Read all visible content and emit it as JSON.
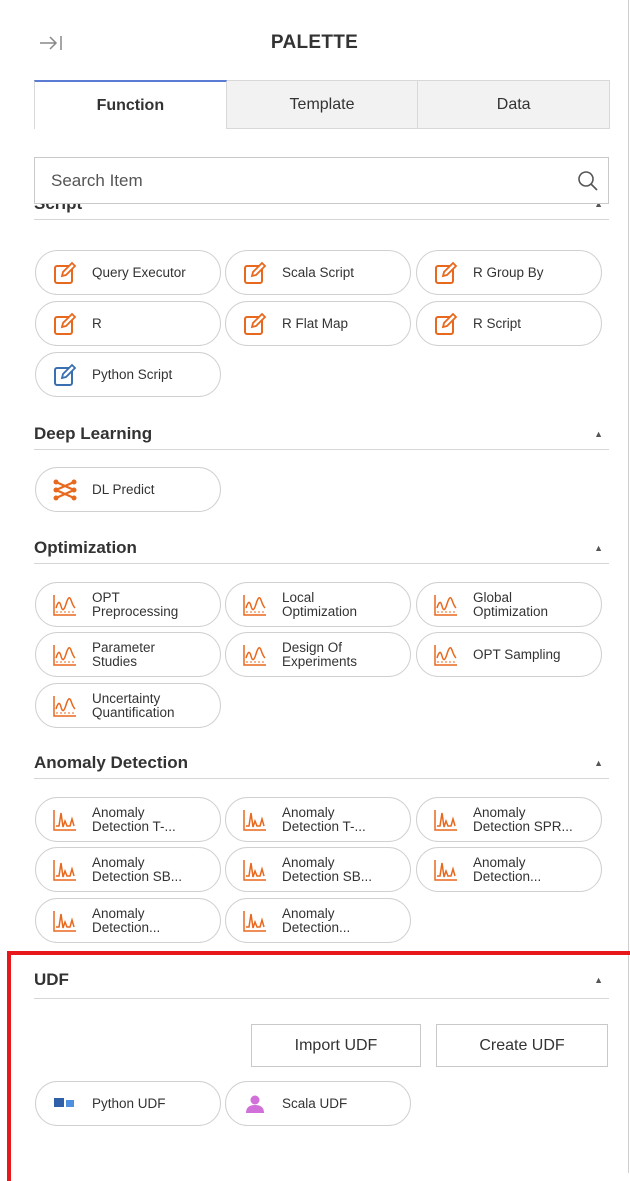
{
  "header": {
    "title": "PALETTE"
  },
  "tabs": [
    {
      "label": "Function",
      "active": true
    },
    {
      "label": "Template",
      "active": false
    },
    {
      "label": "Data",
      "active": false
    }
  ],
  "search": {
    "placeholder": "Search Item",
    "value": ""
  },
  "sections": {
    "script": {
      "title": "Script",
      "items": [
        "Query Executor",
        "Scala Script",
        "R Group By",
        "R",
        "R Flat Map",
        "R Script",
        "Python Script"
      ]
    },
    "deep_learning": {
      "title": "Deep Learning",
      "items": [
        "DL Predict"
      ]
    },
    "optimization": {
      "title": "Optimization",
      "items": [
        [
          "OPT",
          "Preprocessing"
        ],
        [
          "Local",
          "Optimization"
        ],
        [
          "Global",
          "Optimization"
        ],
        [
          "Parameter",
          "Studies"
        ],
        [
          "Design Of",
          "Experiments"
        ],
        [
          "OPT Sampling"
        ],
        [
          "Uncertainty",
          "Quantification"
        ]
      ]
    },
    "anomaly": {
      "title": "Anomaly Detection",
      "items": [
        [
          "Anomaly",
          "Detection T-..."
        ],
        [
          "Anomaly",
          "Detection T-..."
        ],
        [
          "Anomaly",
          "Detection SPR..."
        ],
        [
          "Anomaly",
          "Detection SB..."
        ],
        [
          "Anomaly",
          "Detection SB..."
        ],
        [
          "Anomaly",
          "Detection..."
        ],
        [
          "Anomaly",
          "Detection..."
        ],
        [
          "Anomaly",
          "Detection..."
        ]
      ]
    },
    "udf": {
      "title": "UDF",
      "import_label": "Import UDF",
      "create_label": "Create UDF",
      "items": [
        "Python UDF",
        "Scala UDF"
      ]
    }
  },
  "colors": {
    "accent_orange": "#e8691e",
    "python_blue": "#3a6fb0",
    "highlight_red": "#e8171b",
    "scala_pink": "#d070d8"
  }
}
